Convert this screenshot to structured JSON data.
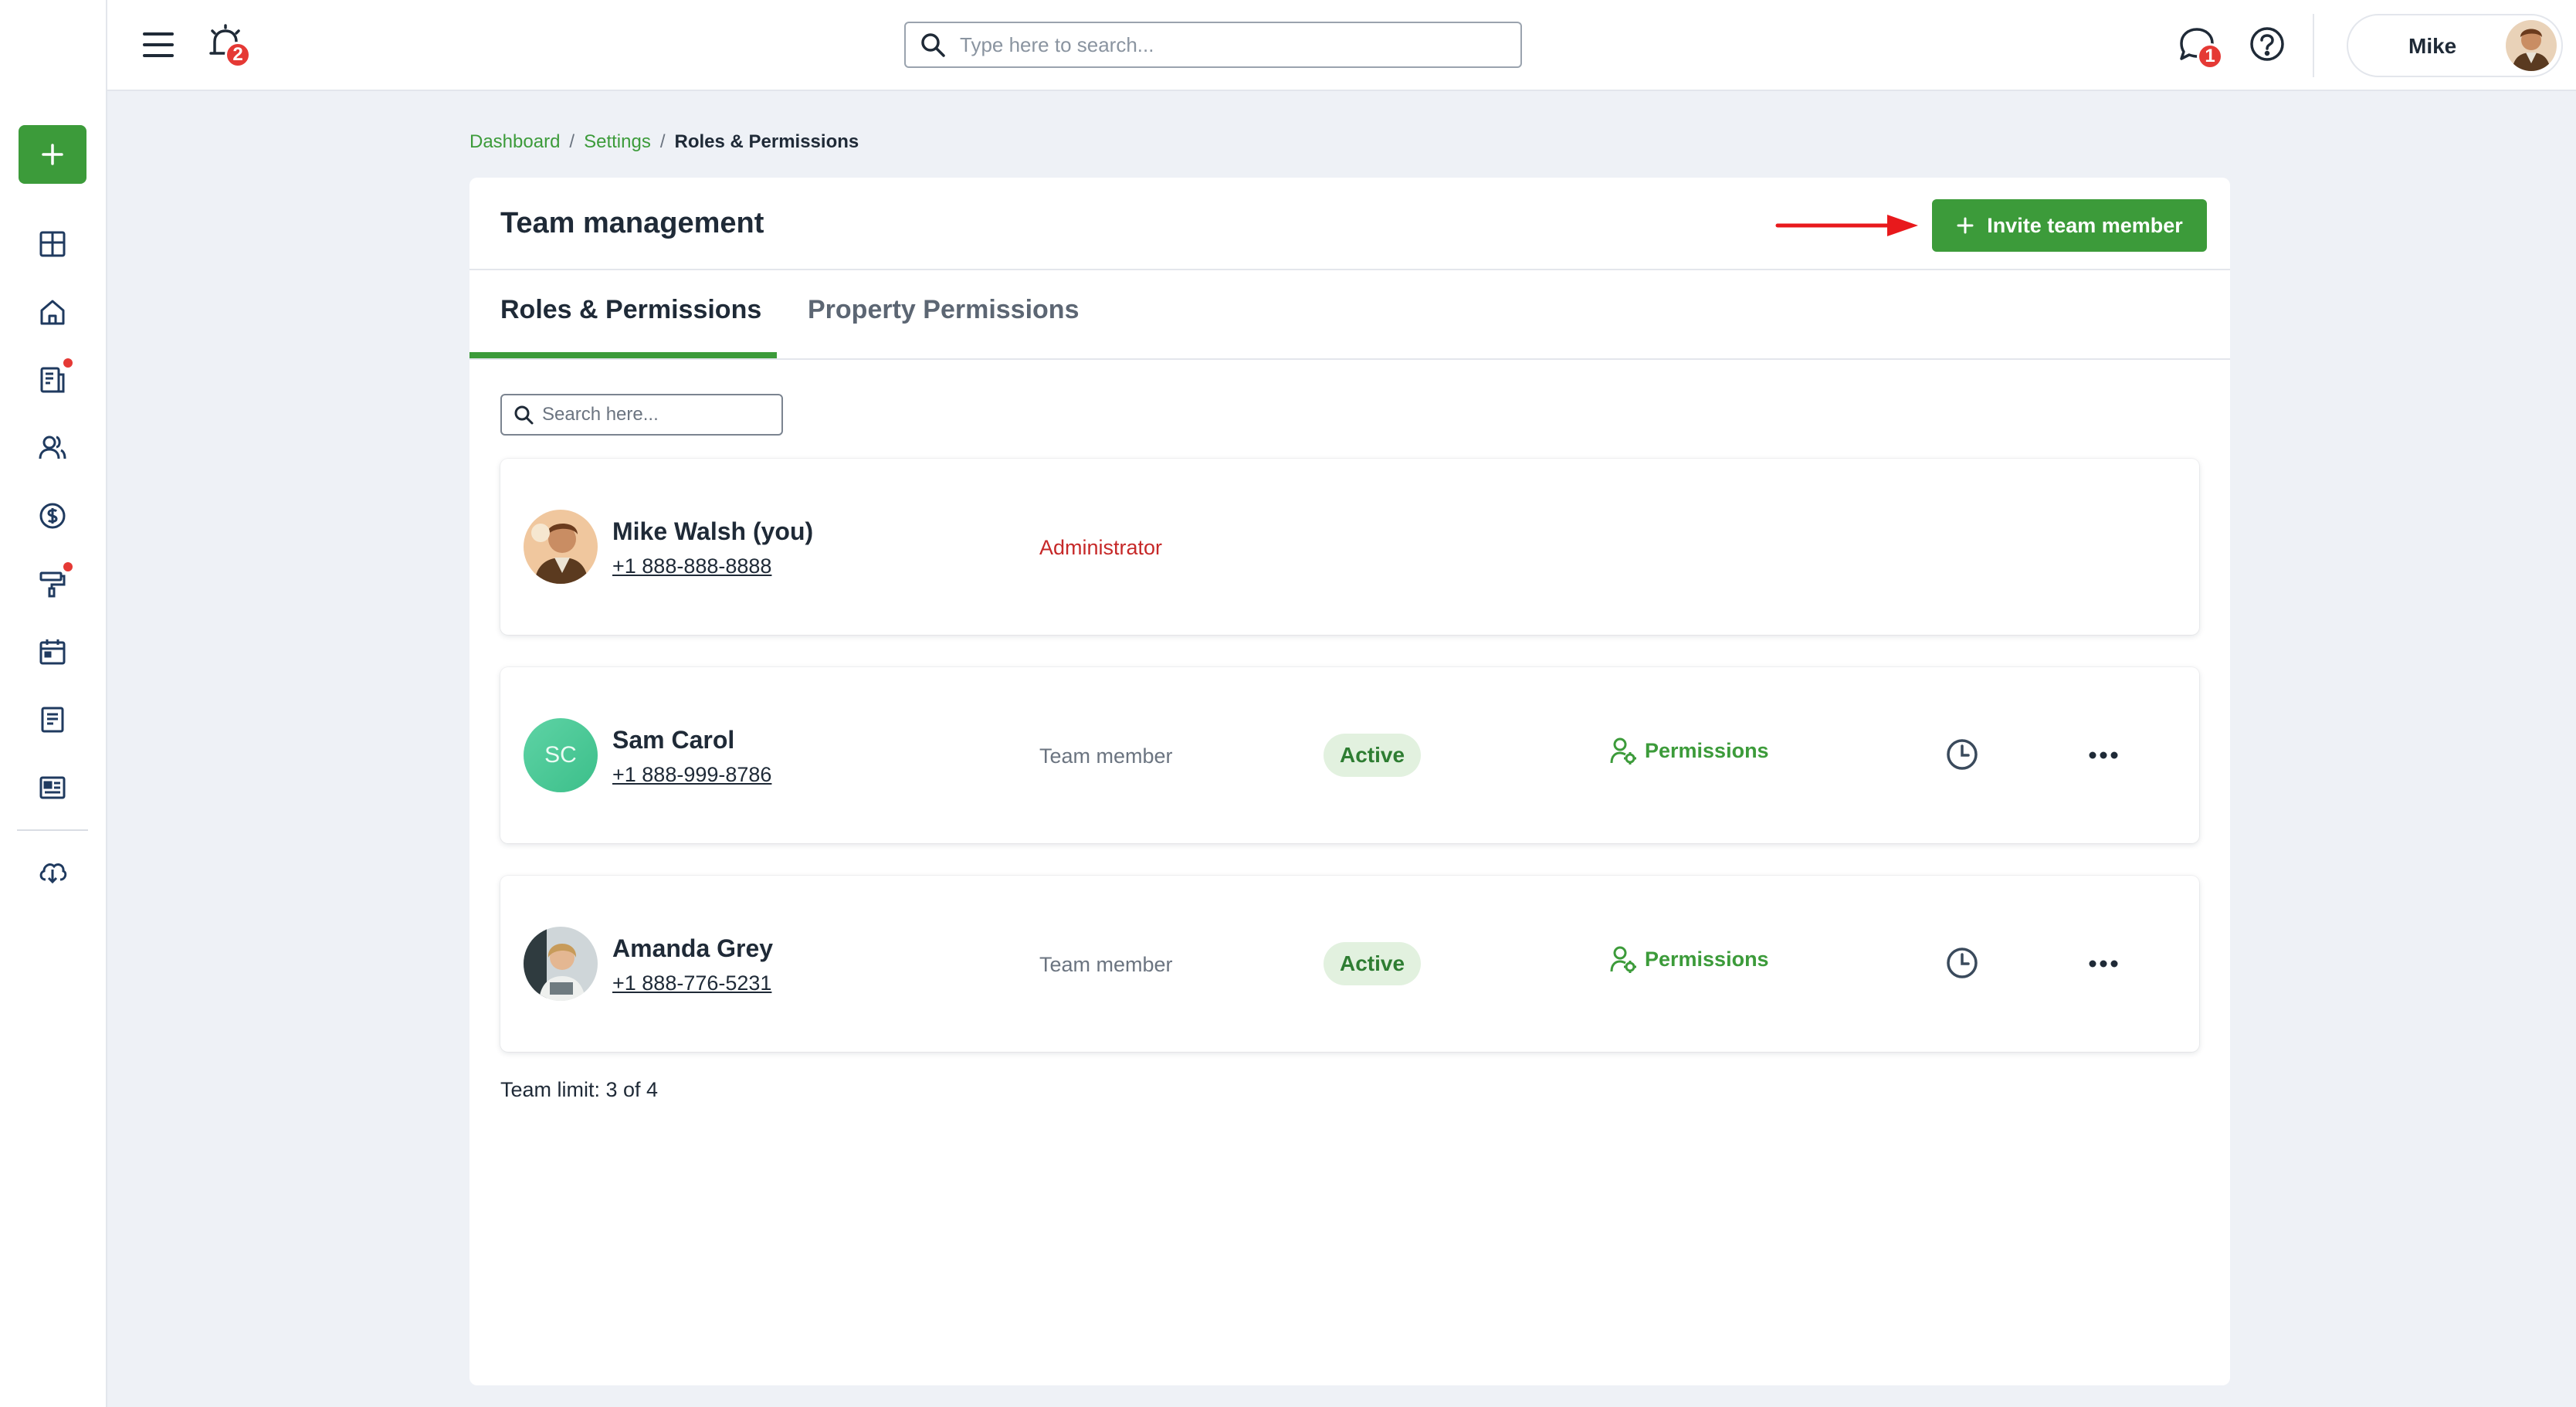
{
  "topbar": {
    "notifications_count": "2",
    "search_placeholder": "Type here to search...",
    "messages_count": "1",
    "user_name": "Mike"
  },
  "breadcrumb": [
    {
      "label": "Dashboard"
    },
    {
      "label": "Settings"
    },
    {
      "label": "Roles & Permissions"
    }
  ],
  "breadcrumb_separator": "/",
  "card": {
    "title": "Team management",
    "invite_label": "Invite team member",
    "tabs": [
      {
        "label": "Roles & Permissions",
        "active": true
      },
      {
        "label": "Property Permissions",
        "active": false
      }
    ],
    "search_placeholder": "Search here..."
  },
  "members": [
    {
      "name": "Mike Walsh (you)",
      "phone": "+1 888-888-8888",
      "role": "Administrator",
      "avatar": "photo-man"
    },
    {
      "name": "Sam Carol",
      "phone": "+1 888-999-8786",
      "role": "Team member",
      "status": "Active",
      "permissions_label": "Permissions",
      "initials": "SC"
    },
    {
      "name": "Amanda Grey",
      "phone": "+1 888-776-5231",
      "role": "Team member",
      "status": "Active",
      "permissions_label": "Permissions",
      "avatar": "photo-woman"
    }
  ],
  "team_limit": "Team limit: 3 of 4",
  "colors": {
    "brand_green": "#3c9b3a",
    "admin_red": "#c62828",
    "badge_red": "#e53935",
    "active_bg": "#e2f1df"
  },
  "sidebar_icons": [
    "plus-icon",
    "layout-icon",
    "home-icon",
    "report-icon",
    "users-icon",
    "dollar-icon",
    "maintenance-icon",
    "calendar-icon",
    "document-icon",
    "listing-icon",
    "download-cloud-icon"
  ]
}
